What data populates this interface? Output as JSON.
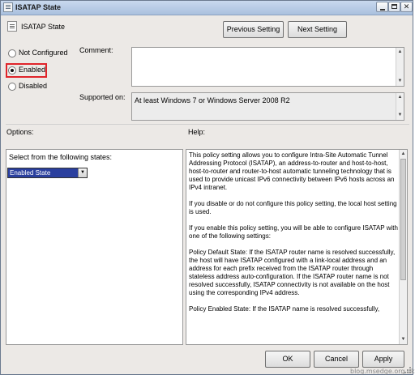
{
  "window": {
    "title": "ISATAP State",
    "controls": {
      "minimize": "minimize",
      "maximize": "maximize",
      "close": "✕"
    }
  },
  "header": {
    "policy_name": "ISATAP State",
    "previous_label": "Previous Setting",
    "next_label": "Next Setting"
  },
  "state": {
    "options": [
      {
        "label": "Not Configured",
        "checked": false
      },
      {
        "label": "Enabled",
        "checked": true
      },
      {
        "label": "Disabled",
        "checked": false
      }
    ]
  },
  "comment": {
    "label": "Comment:",
    "value": ""
  },
  "supported": {
    "label": "Supported on:",
    "value": "At least Windows 7 or Windows Server 2008 R2"
  },
  "options_section": {
    "label": "Options:",
    "select_label": "Select from the following states:",
    "select_value": "Enabled State"
  },
  "help": {
    "label": "Help:",
    "text": "This policy setting allows you to configure Intra-Site Automatic Tunnel Addressing Protocol (ISATAP), an address-to-router and host-to-host, host-to-router and router-to-host automatic tunneling technology that is used to provide unicast IPv6 connectivity between IPv6 hosts across an IPv4 intranet.\n\nIf you disable or do not configure this policy setting, the local host setting is used.\n\nIf you enable this policy setting, you will be able to configure ISATAP with one of the following settings:\n\nPolicy Default State: If the ISATAP router name is resolved successfully, the host will have ISATAP configured with a link-local address and an address for each prefix received from the ISATAP router through stateless address auto-configuration. If the ISATAP router name is not resolved successfully, ISATAP connectivity is not available on the host using the corresponding IPv4 address.\n\nPolicy Enabled State: If the ISATAP name is resolved successfully,"
  },
  "footer": {
    "ok_label": "OK",
    "cancel_label": "Cancel",
    "apply_label": "Apply"
  },
  "watermark": "blog.msedge.org.uk",
  "colors": {
    "highlight": "#e0242a",
    "selection": "#2a3f9e"
  }
}
